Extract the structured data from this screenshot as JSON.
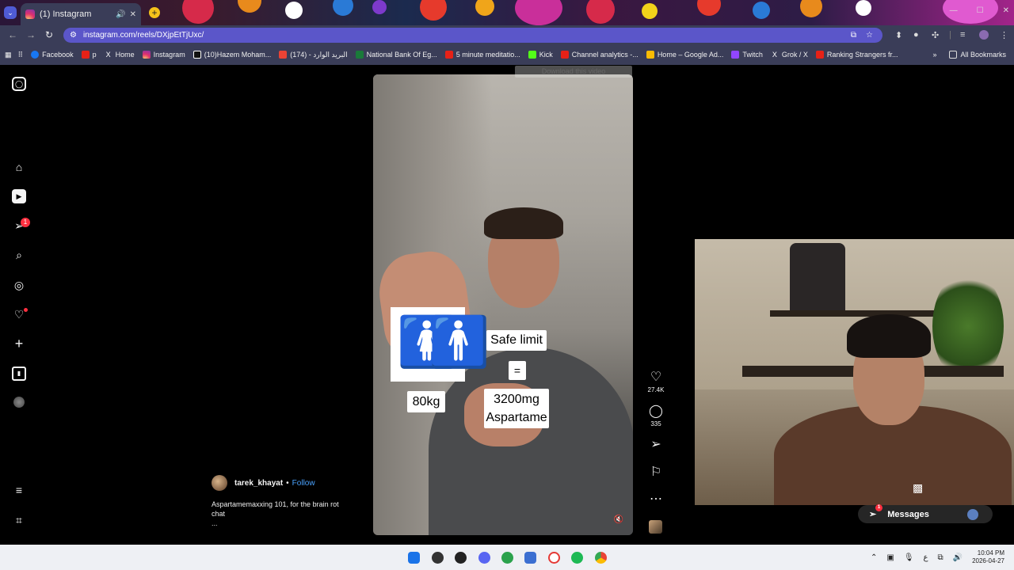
{
  "browser": {
    "tab_title": "(1) Instagram",
    "url": "instagram.com/reels/DXjpEtTjUxc/",
    "bookmarks": [
      "Facebook",
      "p",
      "Home",
      "Instagram",
      "(10)Hazem Moham...",
      "(174) - البريد الوارد",
      "National Bank Of Eg...",
      "5 minute meditatio...",
      "Kick",
      "Channel analytics -...",
      "Home – Google Ad...",
      "Twitch",
      "Grok / X",
      "Ranking Strangers fr..."
    ],
    "all_bookmarks_label": "All Bookmarks",
    "download_overlay": "Download this video"
  },
  "sidebar": {
    "icons": [
      "instagram-logo-icon",
      "home-icon",
      "reels-icon",
      "share-icon",
      "search-icon",
      "explore-icon",
      "heart-icon",
      "create-icon",
      "dashboard-icon",
      "profile-avatar",
      "menu-icon",
      "threads-icon"
    ],
    "share_badge": "1"
  },
  "video": {
    "label_weight": "80kg",
    "label_safe_limit": "Safe limit",
    "label_equals": "=",
    "label_amount": "3200mg",
    "label_substance": "Aspartame"
  },
  "actions": {
    "likes": "27.4K",
    "comments": "335"
  },
  "post": {
    "username": "tarek_khayat",
    "separator": "•",
    "follow_label": "Follow",
    "caption": "Aspartamemaxxing 101, for the brain rot chat",
    "more": "..."
  },
  "messages": {
    "label": "Messages",
    "badge": "1"
  },
  "taskbar": {
    "time": "10:04 PM",
    "date": "2026-04-27",
    "lang": "ع"
  },
  "colors": {
    "instagram_blue": "#4aa3ff",
    "badge_red": "#ff3040",
    "omnibox": "#5b56c9",
    "chrome_toolbar": "#3a3d58"
  }
}
